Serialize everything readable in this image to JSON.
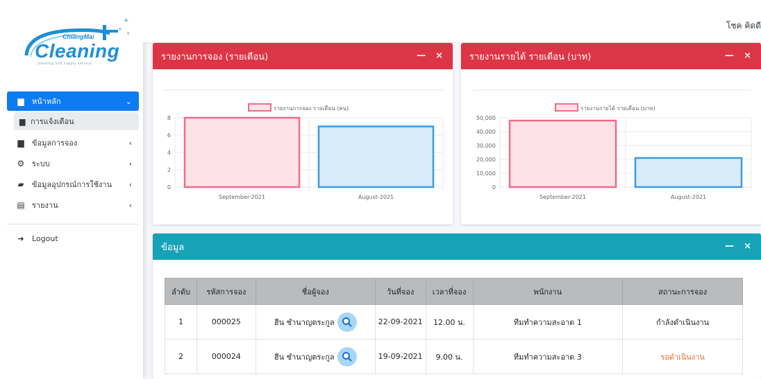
{
  "user": {
    "name": "โชค คิดดี"
  },
  "logo": {
    "brand": "Cleaning",
    "top": "ChiangMai",
    "tagline": "cleaning and supply service"
  },
  "sidebar": {
    "items": [
      {
        "label": "หน้าหลัก",
        "icon": "copy-icon",
        "active": true,
        "chevron": "⌄"
      },
      {
        "label": "การแจ้งเตือน",
        "icon": "copy-icon",
        "sub": true
      },
      {
        "label": "ข้อมูลการจอง",
        "icon": "copy-icon",
        "chevron": "‹"
      },
      {
        "label": "ระบบ",
        "icon": "cogs-icon",
        "chevron": "‹"
      },
      {
        "label": "ข้อมูลอุปกรณ์การใช้งาน",
        "icon": "box-icon",
        "chevron": "‹"
      },
      {
        "label": "รายงาน",
        "icon": "file-icon",
        "chevron": "‹"
      }
    ],
    "logout": "Logout"
  },
  "cards": {
    "booking": {
      "title": "รายงานการจอง (รายเดือน)",
      "minimize": "—",
      "close": "×"
    },
    "income": {
      "title": "รายงานรายได้ รายเดือน (บาท)",
      "minimize": "—",
      "close": "×"
    },
    "data": {
      "title": "ข้อมูล",
      "minimize": "—",
      "close": "×"
    }
  },
  "colors": {
    "pink_fill": "#fde3e8",
    "pink_stroke": "#f06b8a",
    "blue_fill": "#d7ebf8",
    "blue_stroke": "#3c9be0"
  },
  "chart_data": [
    {
      "type": "bar",
      "legend": "รายงานการจอง รายเดือน (คน)",
      "categories": [
        "September-2021",
        "August-2021"
      ],
      "values": [
        8,
        7
      ],
      "ylim": [
        0,
        8
      ],
      "yticks": [
        "0",
        "2",
        "4",
        "6",
        "8"
      ]
    },
    {
      "type": "bar",
      "legend": "รายงานรายได้ รายเดือน (บาท)",
      "categories": [
        "September-2021",
        "August-2021"
      ],
      "values": [
        48000,
        21000
      ],
      "ylim": [
        0,
        50000
      ],
      "yticks": [
        "0",
        "10,000",
        "20,000",
        "30,000",
        "40,000",
        "50,000"
      ]
    }
  ],
  "table": {
    "headers": [
      "ลำดับ",
      "รหัสการจอง",
      "ชื่อผู้จอง",
      "วันที่จอง",
      "เวลาที่จอง",
      "พนักงาน",
      "สถานะการจอง"
    ],
    "rows": [
      {
        "no": "1",
        "code": "000025",
        "name": "ฮีน ชำนาญตระกูล",
        "date": "22-09-2021",
        "time": "12.00 น.",
        "staff": "ทีมทำความสะอาด 1",
        "status": "กำลังดำเนินงาน"
      },
      {
        "no": "2",
        "code": "000024",
        "name": "ฮีน ชำนาญตระกูล",
        "date": "19-09-2021",
        "time": "9.00 น.",
        "staff": "ทีมทำความสะอาด 3",
        "status": "รอดำเนินงาน"
      }
    ]
  }
}
